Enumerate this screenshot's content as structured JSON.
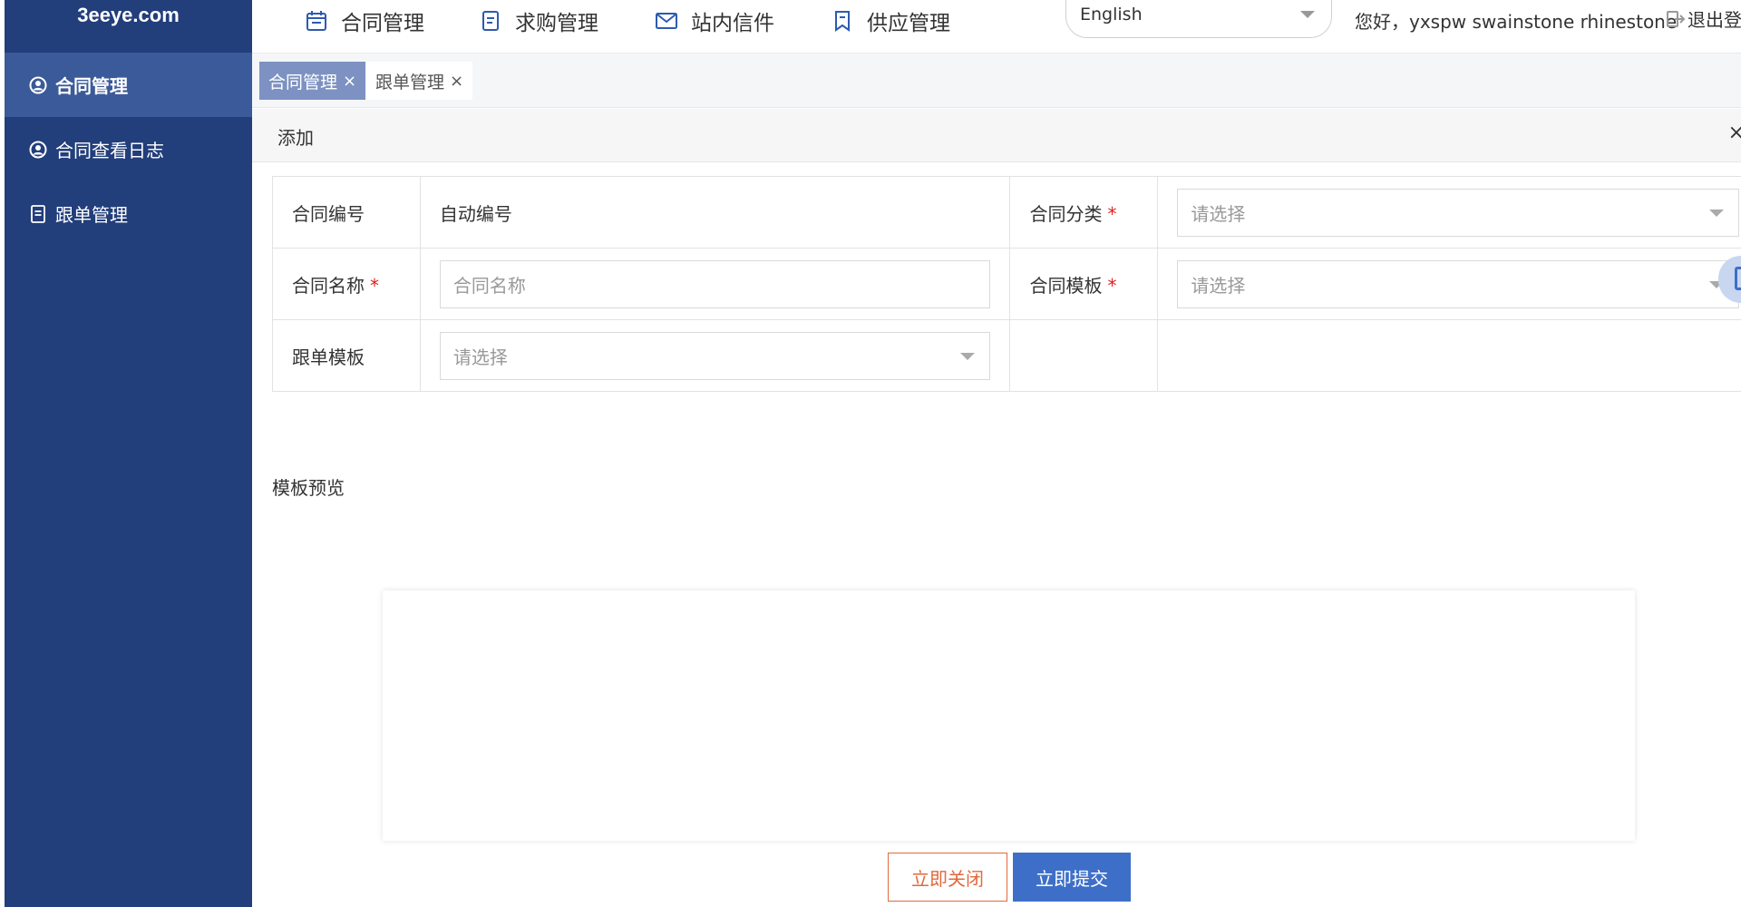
{
  "sidebar": {
    "logo": "3eeye.com",
    "items": [
      {
        "label": "合同管理",
        "icon": "user-circle-icon",
        "active": true
      },
      {
        "label": "合同查看日志",
        "icon": "user-circle-icon",
        "active": false
      },
      {
        "label": "跟单管理",
        "icon": "document-icon",
        "active": false
      }
    ]
  },
  "topnav": {
    "items": [
      {
        "label": "合同管理",
        "icon": "calendar-icon"
      },
      {
        "label": "求购管理",
        "icon": "document-icon"
      },
      {
        "label": "站内信件",
        "icon": "mail-icon"
      },
      {
        "label": "供应管理",
        "icon": "bookmark-icon"
      }
    ],
    "language": "English",
    "greeting": "您好，yxspw swainstone rhinestone",
    "logout": "退出登"
  },
  "tabs": [
    {
      "label": "合同管理",
      "active": true
    },
    {
      "label": "跟单管理",
      "active": false
    }
  ],
  "panel": {
    "title": "添加"
  },
  "form": {
    "contract_no_label": "合同编号",
    "contract_no_value": "自动编号",
    "category_label": "合同分类",
    "category_placeholder": "请选择",
    "name_label": "合同名称",
    "name_placeholder": "合同名称",
    "template_label": "合同模板",
    "template_placeholder": "请选择",
    "follow_template_label": "跟单模板",
    "follow_template_placeholder": "请选择",
    "required_mark": "*"
  },
  "preview": {
    "title": "模板预览"
  },
  "buttons": {
    "close": "立即关闭",
    "submit": "立即提交"
  },
  "colors": {
    "sidebar": "#223e7b",
    "sidebar_active": "#3b5a99",
    "primary": "#3e6fc8",
    "danger": "#e06a3c",
    "required": "#e02020"
  }
}
